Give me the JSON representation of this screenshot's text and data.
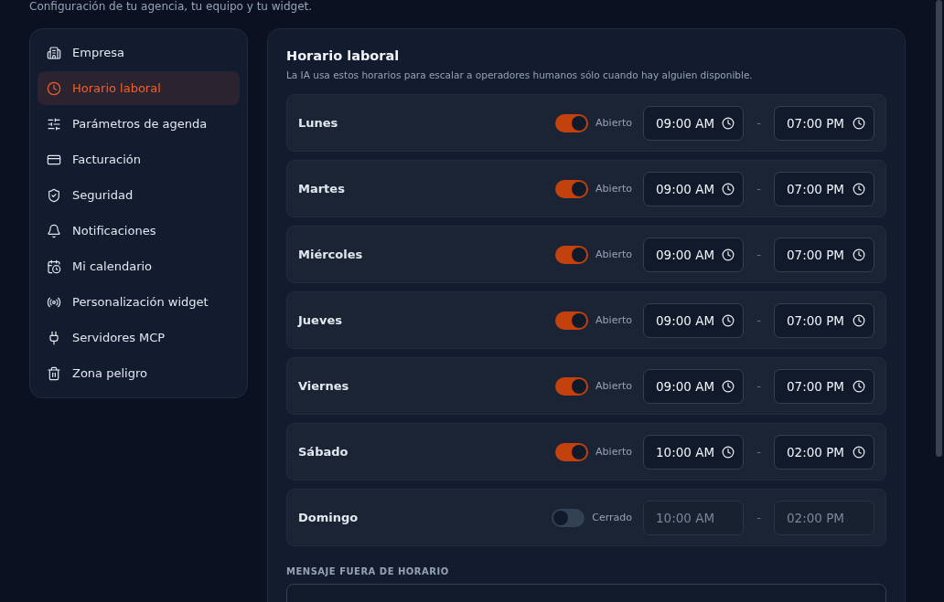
{
  "page": {
    "subtitle": "Configuración de tu agencia, tu equipo y tu widget."
  },
  "sidebar": {
    "items": [
      {
        "label": "Empresa",
        "selected": false
      },
      {
        "label": "Horario laboral",
        "selected": true
      },
      {
        "label": "Parámetros de agenda",
        "selected": false
      },
      {
        "label": "Facturación",
        "selected": false
      },
      {
        "label": "Seguridad",
        "selected": false
      },
      {
        "label": "Notificaciones",
        "selected": false
      },
      {
        "label": "Mi calendario",
        "selected": false
      },
      {
        "label": "Personalización widget",
        "selected": false
      },
      {
        "label": "Servidores MCP",
        "selected": false
      },
      {
        "label": "Zona peligro",
        "selected": false
      }
    ]
  },
  "schedule": {
    "title": "Horario laboral",
    "description": "La IA usa estos horarios para escalar a operadores humanos sólo cuando hay alguien disponible.",
    "days": [
      {
        "name": "Lunes",
        "open": true,
        "status": "Abierto",
        "from": "09:00 AM",
        "separator": "-",
        "to": "07:00 PM"
      },
      {
        "name": "Martes",
        "open": true,
        "status": "Abierto",
        "from": "09:00 AM",
        "separator": "-",
        "to": "07:00 PM"
      },
      {
        "name": "Miércoles",
        "open": true,
        "status": "Abierto",
        "from": "09:00 AM",
        "separator": "-",
        "to": "07:00 PM"
      },
      {
        "name": "Jueves",
        "open": true,
        "status": "Abierto",
        "from": "09:00 AM",
        "separator": "-",
        "to": "07:00 PM"
      },
      {
        "name": "Viernes",
        "open": true,
        "status": "Abierto",
        "from": "09:00 AM",
        "separator": "-",
        "to": "07:00 PM"
      },
      {
        "name": "Sábado",
        "open": true,
        "status": "Abierto",
        "from": "10:00 AM",
        "separator": "-",
        "to": "02:00 PM"
      },
      {
        "name": "Domingo",
        "open": false,
        "status": "Cerrado",
        "from": "10:00 AM",
        "separator": "-",
        "to": "02:00 PM"
      }
    ],
    "message_label": "MENSAJE FUERA DE HORARIO"
  }
}
